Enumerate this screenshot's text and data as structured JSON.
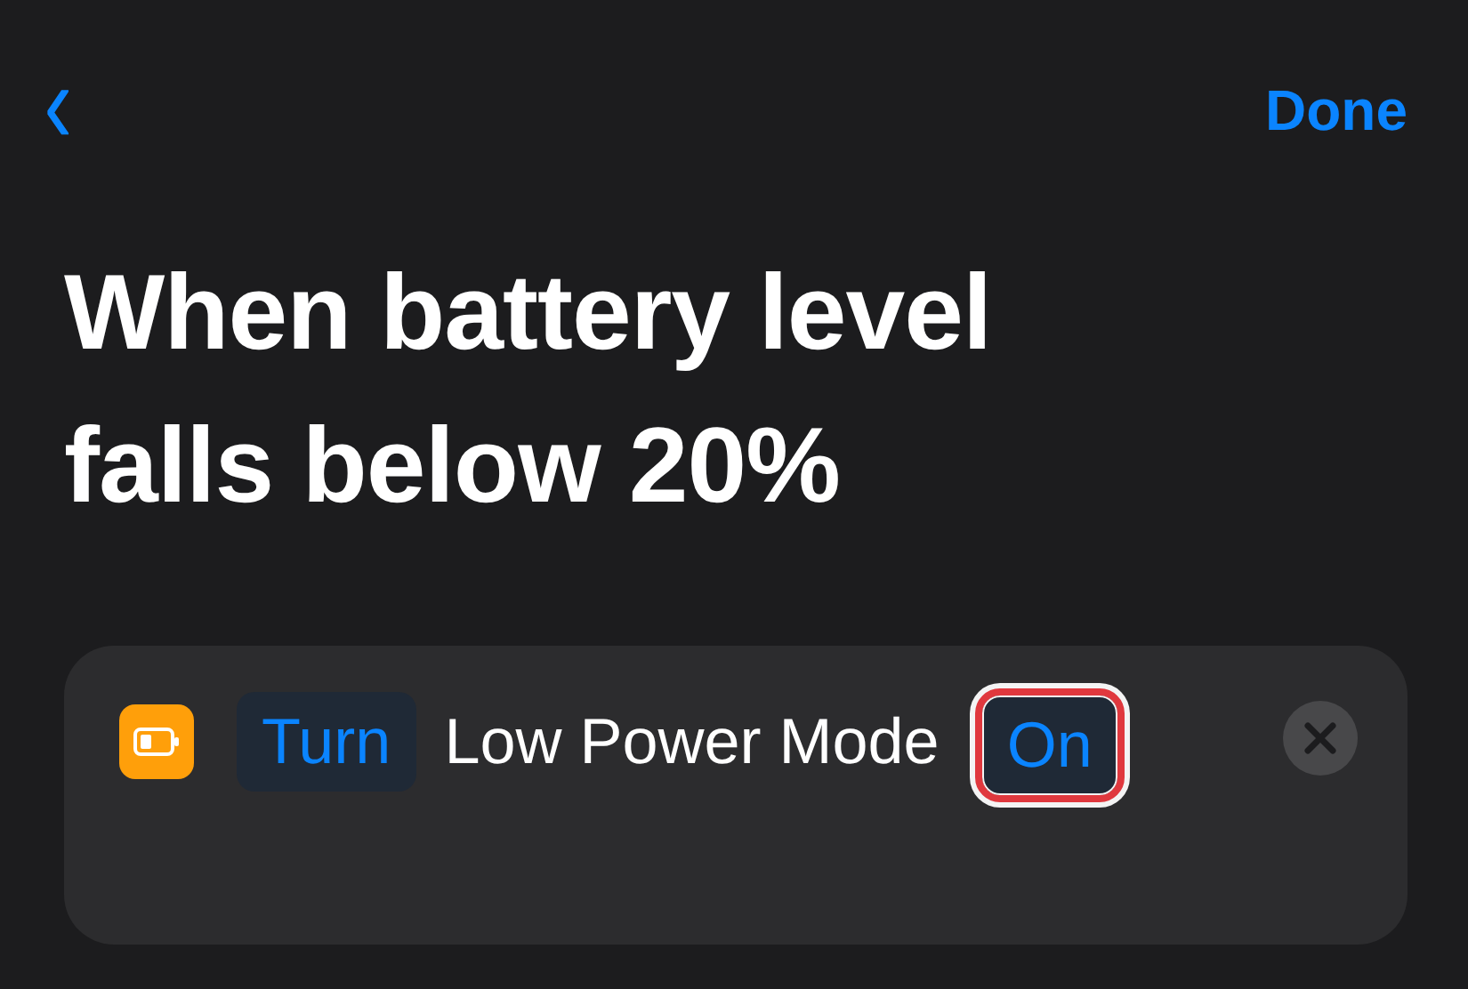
{
  "nav": {
    "back": "‹",
    "done": "Done"
  },
  "title": "When battery level falls below 20%",
  "action": {
    "tokens": [
      {
        "kind": "param",
        "text": "Turn",
        "highlighted": false
      },
      {
        "kind": "plain",
        "text": "Low Power Mode"
      },
      {
        "kind": "param",
        "text": "On",
        "highlighted": true
      }
    ]
  }
}
